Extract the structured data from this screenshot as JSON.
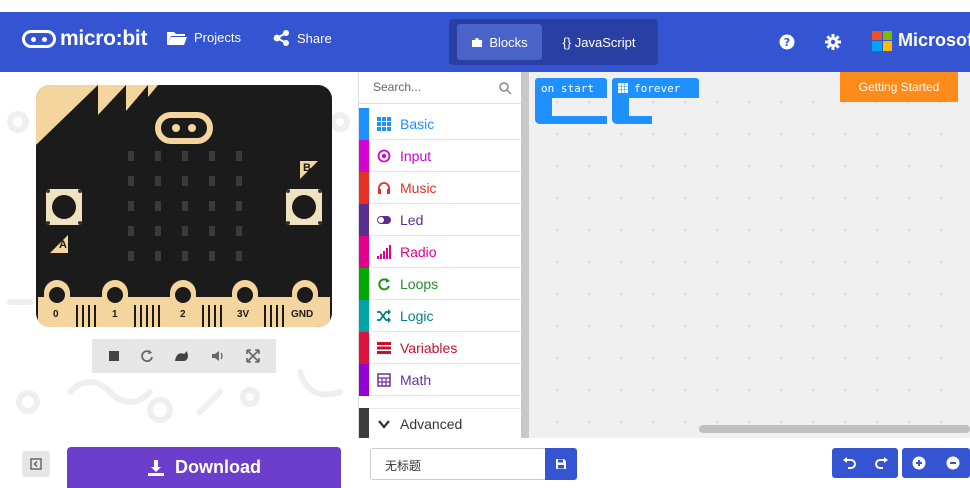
{
  "header": {
    "logo_text": "micro:bit",
    "projects_label": "Projects",
    "share_label": "Share",
    "modes": [
      {
        "label": "Blocks",
        "icon": "puzzle-icon",
        "active": true
      },
      {
        "label": "{} JavaScript",
        "icon": "",
        "active": false
      }
    ],
    "help_icon": "help-icon",
    "settings_icon": "gear-icon",
    "brand_label": "Microsoft",
    "colors": {
      "bar": "#3454d1"
    }
  },
  "simulator": {
    "pin_labels": [
      "0",
      "1",
      "2",
      "3V",
      "GND"
    ],
    "button_labels": [
      "A",
      "B"
    ],
    "toolbar_icons": [
      "stop-icon",
      "restart-icon",
      "slowmo-icon",
      "mute-icon",
      "fullscreen-icon"
    ]
  },
  "toolbox": {
    "search_placeholder": "Search...",
    "categories": [
      {
        "label": "Basic",
        "color": "#1e90ff",
        "icon": "grid-icon"
      },
      {
        "label": "Input",
        "color": "#d400d4",
        "icon": "target-icon"
      },
      {
        "label": "Music",
        "color": "#e63022",
        "icon": "headphones-icon"
      },
      {
        "label": "Led",
        "color": "#5c2d91",
        "icon": "toggle-icon"
      },
      {
        "label": "Radio",
        "color": "#e3008c",
        "icon": "signal-bars-icon"
      },
      {
        "label": "Loops",
        "color": "#00aa00",
        "icon": "refresh-icon"
      },
      {
        "label": "Logic",
        "color": "#00a4a6",
        "icon": "shuffle-icon"
      },
      {
        "label": "Variables",
        "color": "#dc143c",
        "icon": "list-icon"
      },
      {
        "label": "Math",
        "color": "#9400d3",
        "icon": "calculator-icon"
      }
    ],
    "advanced_label": "Advanced",
    "advanced_color": "#3c3c3c"
  },
  "workspace": {
    "blocks": [
      {
        "label": "on start",
        "color": "#1e90ff"
      },
      {
        "label": "forever",
        "color": "#1e90ff",
        "icon": "grid-icon"
      }
    ],
    "getting_started_label": "Getting Started",
    "getting_started_color": "#ff8c1a"
  },
  "footer": {
    "download_label": "Download",
    "download_color": "#6c3ecb",
    "project_name": "无标题",
    "undo_icon": "undo-icon",
    "redo_icon": "redo-icon",
    "zoom_in_icon": "zoom-in-icon",
    "zoom_out_icon": "zoom-out-icon"
  }
}
